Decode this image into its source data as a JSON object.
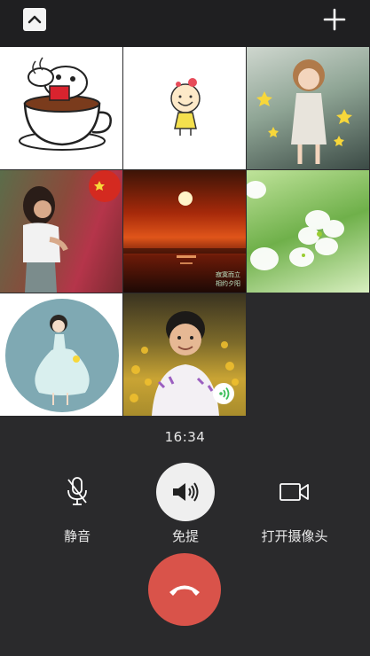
{
  "call": {
    "duration": "16:34"
  },
  "controls": {
    "mute_label": "静音",
    "speaker_label": "免提",
    "camera_label": "打开摄像头"
  },
  "participants": [
    {
      "avatar": "cartoon-dog-coffee"
    },
    {
      "avatar": "cartoon-girl"
    },
    {
      "avatar": "illustrated-woman-stars"
    },
    {
      "avatar": "photo-girl-red-leaves"
    },
    {
      "avatar": "photo-sunset",
      "caption_lines": [
        "寂寞而立",
        "相约夕阳"
      ]
    },
    {
      "avatar": "photo-white-flowers"
    },
    {
      "avatar": "cartoon-girl-blue-dress"
    },
    {
      "avatar": "photo-child-flowers",
      "speaking": true
    }
  ],
  "colors": {
    "hangup": "#d9534a",
    "background": "#2a2a2c",
    "speaking": "#3cbf5a"
  },
  "icons": [
    "chevron-up-icon",
    "plus-icon",
    "microphone-muted-icon",
    "speaker-icon",
    "video-camera-icon",
    "phone-hangup-icon",
    "speaking-wave-icon"
  ]
}
